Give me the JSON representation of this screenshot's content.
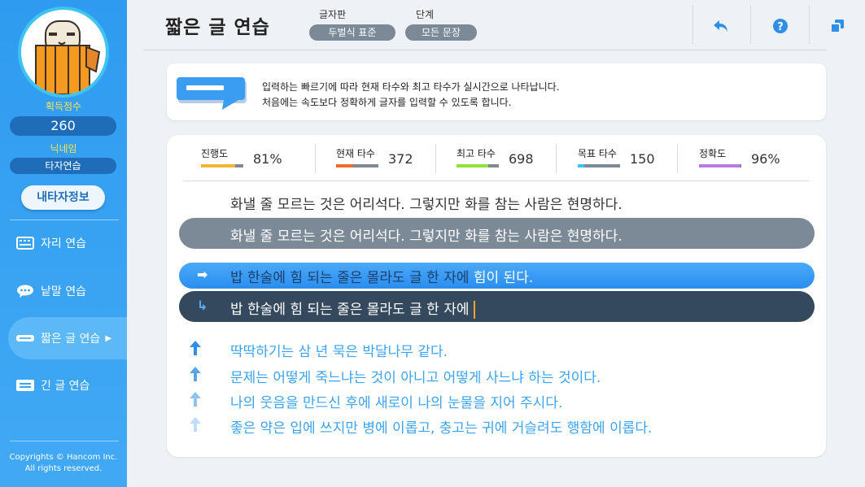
{
  "sidebar": {
    "score_label": "획득점수",
    "score_value": "260",
    "nickname_label": "닉네임",
    "nickname_value": "타자연습",
    "my_info_button": "내타자정보",
    "nav": [
      {
        "label": "자리 연습",
        "icon": "keyboard-icon"
      },
      {
        "label": "낱말 연습",
        "icon": "speech-bubble-icon"
      },
      {
        "label": "짧은 글 연습",
        "icon": "short-text-icon",
        "active": true
      },
      {
        "label": "긴 글 연습",
        "icon": "long-text-icon"
      }
    ],
    "copyright_line1": "Copyrights © Hancom Inc.",
    "copyright_line2": "All rights reserved."
  },
  "header": {
    "title": "짧은 글 연습",
    "keyboard_label": "글자판",
    "keyboard_value": "두벌식 표준",
    "level_label": "단계",
    "level_value": "모든 문장",
    "buttons": [
      "back-icon",
      "help-icon",
      "window-icon"
    ]
  },
  "info": {
    "line1": "입력하는 빠르기에 따라 현재 타수와 최고 타수가 실시간으로 나타납니다.",
    "line2": "처음에는 속도보다 정확하게 글자를 입력할 수 있도록 합니다."
  },
  "stats": {
    "progress_label": "진행도",
    "progress_value": "81%",
    "progress_fraction": 0.81,
    "current_label": "현재 타수",
    "current_value": "372",
    "current_fraction": 0.4,
    "best_label": "최고 타수",
    "best_value": "698",
    "best_fraction": 0.75,
    "target_label": "목표 타수",
    "target_value": "150",
    "target_fraction": 0.16,
    "accuracy_label": "정확도",
    "accuracy_value": "96%",
    "accuracy_fraction": 0.96,
    "colors": {
      "progress": "#f6b233",
      "current": "#f06a2a",
      "best": "#8fe23a",
      "target": "#3cc1f3",
      "accuracy": "#b77be8"
    }
  },
  "practice": {
    "previous_text": "화낼 줄 모르는 것은 어리석다. 그렇지만 화를 참는 사람은 현명하다.",
    "previous_typed": "화낼 줄 모르는 것은 어리석다. 그렇지만 화를 참는 사람은 현명하다.",
    "current_typed_part": "밥 한술에 힘 되는 줄은 몰라도 글 한 자에 ",
    "current_remaining_part": "힘이 된다.",
    "input_value": "밥 한술에 힘 되는 줄은 몰라도 글 한 자에",
    "upcoming": [
      "딱딱하기는 삼 년 묵은 박달나무 같다.",
      "문제는 어떻게 죽느냐는 것이 아니고 어떻게 사느냐 하는 것이다.",
      "나의 웃음을 만드신 후에 새로이 나의 눈물을 지어 주시다.",
      "좋은 약은 입에 쓰지만 병에 이롭고, 충고는 귀에 거슬려도 행함에 이롭다."
    ]
  }
}
